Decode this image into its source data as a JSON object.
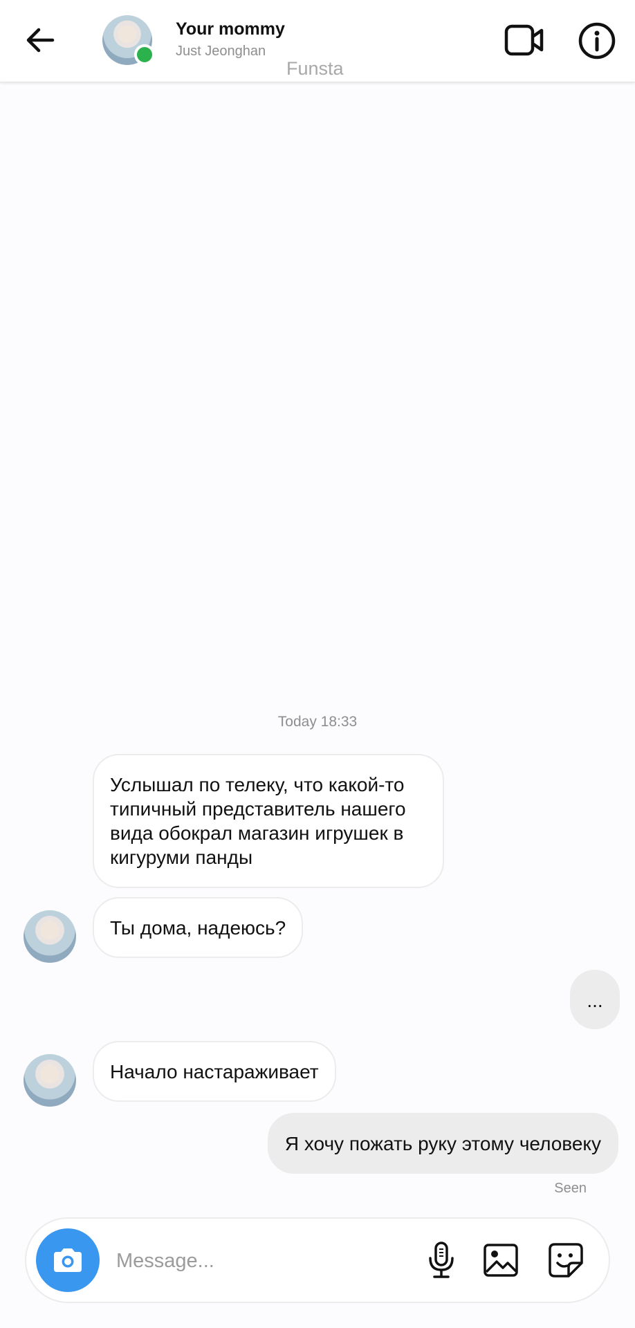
{
  "header": {
    "name": "Your mommy",
    "subtitle": "Just Jeonghan",
    "tag": "Funsta"
  },
  "chat": {
    "timestamp": "Today 18:33",
    "messages": [
      {
        "sender": "them",
        "text": "Услышал по телеку, что какой-то типичный представитель нашего вида обокрал магазин игрушек в кигуруми панды"
      },
      {
        "sender": "them",
        "text": "Ты дома, надеюсь?"
      },
      {
        "sender": "me",
        "text": "..."
      },
      {
        "sender": "them",
        "text": "Начало настараживает"
      },
      {
        "sender": "me",
        "text": "Я хочу пожать руку этому человеку"
      }
    ],
    "seen_label": "Seen"
  },
  "composer": {
    "placeholder": "Message..."
  },
  "colors": {
    "accent": "#3a97f0",
    "online": "#2bb24c"
  },
  "icons": {
    "back": "arrow-left-icon",
    "video": "video-camera-icon",
    "info": "info-icon",
    "camera": "camera-icon",
    "mic": "microphone-icon",
    "gallery": "image-icon",
    "sticker": "sticker-icon"
  }
}
